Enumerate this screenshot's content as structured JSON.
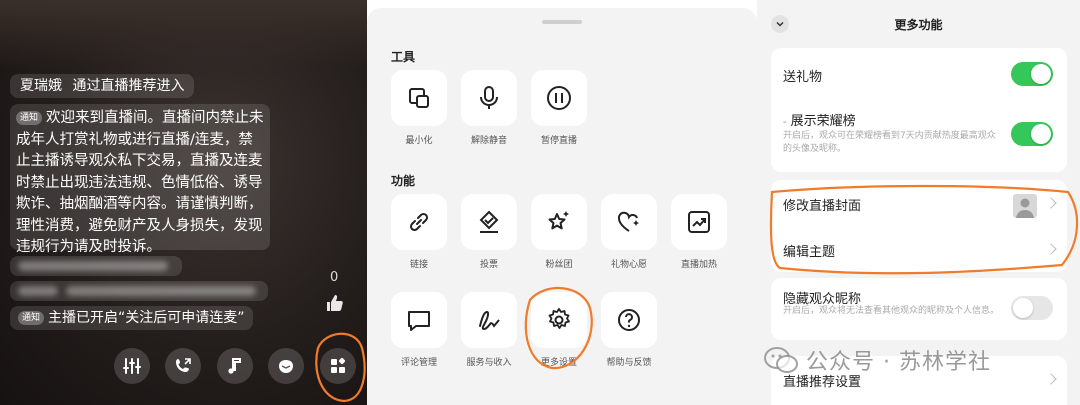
{
  "live": {
    "entry_user": "夏瑞娥",
    "entry_text": "通过直播推荐进入",
    "notice_tag": "通知",
    "notice_text": "欢迎来到直播间。直播间内禁止未成年人打赏礼物或进行直播/连麦，禁止主播诱导观众私下交易，直播及连麦时禁止出现违法违规、色情低俗、诱导欺诈、抽烟酗酒等内容。请谨慎判断，理性消费，避免财产及人身损失，发现违规行为请及时投诉。",
    "system_tag": "通知",
    "system_text": "主播已开启“关注后可申请连麦”",
    "like_count": "0",
    "toolbar": [
      {
        "icon": "equalizer-icon"
      },
      {
        "icon": "co-host-call-icon"
      },
      {
        "icon": "music-note-icon"
      },
      {
        "icon": "gift-box-icon"
      },
      {
        "icon": "grid-more-icon"
      }
    ]
  },
  "tools_sheet": {
    "section_tools": "工具",
    "tools": [
      {
        "label": "最小化",
        "icon": "minimize-icon"
      },
      {
        "label": "解除静音",
        "icon": "microphone-icon"
      },
      {
        "label": "暂停直播",
        "icon": "pause-icon"
      }
    ],
    "section_functions": "功能",
    "functions_row1": [
      {
        "label": "链接",
        "icon": "link-icon"
      },
      {
        "label": "投票",
        "icon": "vote-icon"
      },
      {
        "label": "粉丝团",
        "icon": "fan-club-star-icon"
      },
      {
        "label": "礼物心愿",
        "icon": "heart-wish-icon"
      },
      {
        "label": "直播加热",
        "icon": "trending-chart-icon"
      }
    ],
    "functions_row2": [
      {
        "label": "评论管理",
        "icon": "comment-icon"
      },
      {
        "label": "服务与收入",
        "icon": "service-income-icon"
      },
      {
        "label": "更多设置",
        "icon": "gear-icon"
      },
      {
        "label": "帮助与反馈",
        "icon": "help-icon"
      }
    ]
  },
  "more_functions": {
    "title": "更多功能",
    "send_gift_label": "送礼物",
    "send_gift_on": true,
    "honor_label": "展示荣耀榜",
    "honor_desc": "开启后，观众可在荣耀榜看到7天内贡献热度最高观众的头像及昵称。",
    "honor_on": true,
    "edit_cover_label": "修改直播封面",
    "edit_theme_label": "编辑主题",
    "hide_nick_label": "隐藏观众昵称",
    "hide_nick_desc": "开启后，观众将无法查看其他观众的昵称及个人信息。",
    "hide_nick_on": false,
    "recommend_label": "直播推荐设置"
  },
  "watermark": {
    "text": "公众号 · 苏林学社"
  },
  "colors": {
    "toggle_on": "#35c759",
    "annotation": "#f07b2a"
  }
}
